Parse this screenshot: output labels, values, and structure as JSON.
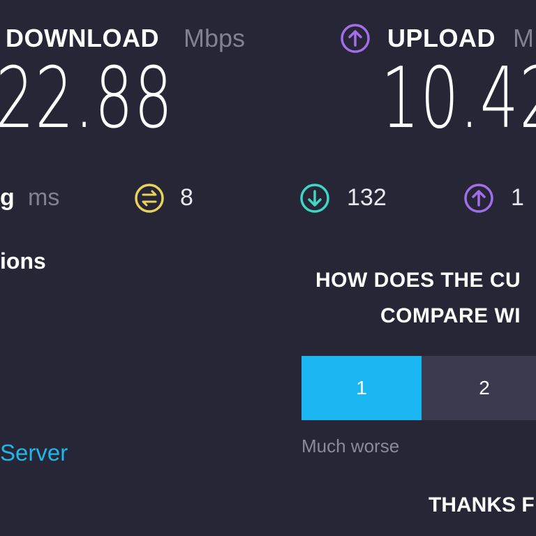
{
  "download": {
    "title": "DOWNLOAD",
    "unit": "Mbps",
    "value": "22.88",
    "icon": "download-icon"
  },
  "upload": {
    "title": "UPLOAD",
    "unit": "M",
    "value": "10.42",
    "icon": "upload-icon"
  },
  "ping": {
    "label_fragment": "g",
    "unit": "ms",
    "jitter_value": "8",
    "download_latency": "132",
    "upload_latency": "1",
    "colors": {
      "jitter": "#e8d35a",
      "download": "#3ed6c4",
      "upload": "#a36ee8"
    }
  },
  "left_panel": {
    "section_title_fragment": "ions",
    "server_link": "Server"
  },
  "survey": {
    "question_line1": "HOW DOES THE CU",
    "question_line2": "COMPARE WI",
    "options": [
      "1",
      "2"
    ],
    "selected": "1",
    "low_hint": "Much worse",
    "thanks": "THANKS F"
  },
  "colors": {
    "background": "#262637",
    "accent": "#1bb7f2",
    "upload_icon": "#a36ee8",
    "muted_text": "#80838f"
  }
}
